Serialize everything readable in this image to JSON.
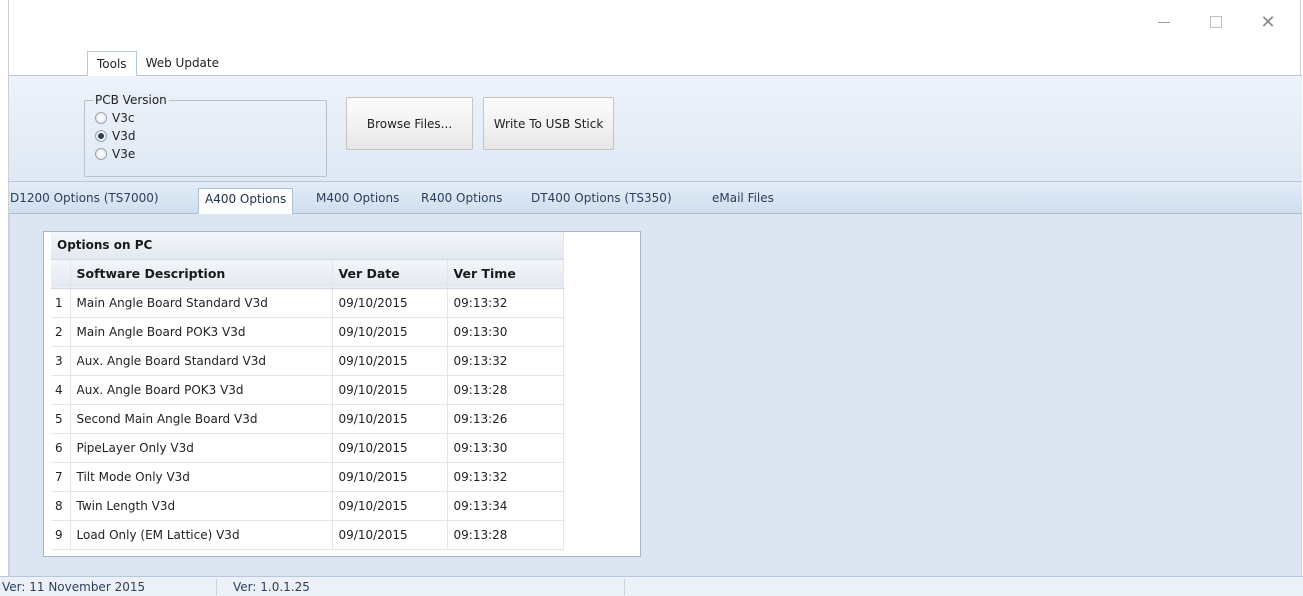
{
  "window": {
    "controls": {
      "minimize": "—",
      "maximize": "☐",
      "close": "✕"
    }
  },
  "top_tabs": [
    {
      "label": "Tools",
      "active": true
    },
    {
      "label": "Web Update",
      "active": false
    }
  ],
  "pcb_version": {
    "title": "PCB Version",
    "options": [
      {
        "label": "V3c",
        "checked": false
      },
      {
        "label": "V3d",
        "checked": true
      },
      {
        "label": "V3e",
        "checked": false
      }
    ]
  },
  "buttons": {
    "browse": "Browse Files...",
    "write": "Write To USB Stick"
  },
  "option_tabs": [
    {
      "label": "D1200 Options (TS7000)",
      "active": false
    },
    {
      "label": "A400 Options",
      "active": true
    },
    {
      "label": "M400 Options",
      "active": false
    },
    {
      "label": "R400 Options",
      "active": false
    },
    {
      "label": "DT400 Options (TS350)",
      "active": false
    },
    {
      "label": "eMail Files",
      "active": false
    }
  ],
  "grid": {
    "group_title": "Options on PC",
    "columns": [
      "Software Description",
      "Ver Date",
      "Ver Time"
    ],
    "rows": [
      {
        "num": "1",
        "desc": "Main Angle Board Standard V3d",
        "date": "09/10/2015",
        "time": "09:13:32"
      },
      {
        "num": "2",
        "desc": "Main Angle Board POK3 V3d",
        "date": "09/10/2015",
        "time": "09:13:30"
      },
      {
        "num": "3",
        "desc": "Aux. Angle Board Standard V3d",
        "date": "09/10/2015",
        "time": "09:13:32"
      },
      {
        "num": "4",
        "desc": "Aux. Angle Board POK3 V3d",
        "date": "09/10/2015",
        "time": "09:13:28"
      },
      {
        "num": "5",
        "desc": "Second Main Angle Board V3d",
        "date": "09/10/2015",
        "time": "09:13:26"
      },
      {
        "num": "6",
        "desc": "PipeLayer Only V3d",
        "date": "09/10/2015",
        "time": "09:13:30"
      },
      {
        "num": "7",
        "desc": "Tilt Mode Only V3d",
        "date": "09/10/2015",
        "time": "09:13:32"
      },
      {
        "num": "8",
        "desc": "Twin Length V3d",
        "date": "09/10/2015",
        "time": "09:13:34"
      },
      {
        "num": "9",
        "desc": "Load Only (EM Lattice) V3d",
        "date": "09/10/2015",
        "time": "09:13:28"
      }
    ]
  },
  "status": {
    "left": "Ver: 11 November 2015",
    "right": "Ver: 1.0.1.25"
  }
}
